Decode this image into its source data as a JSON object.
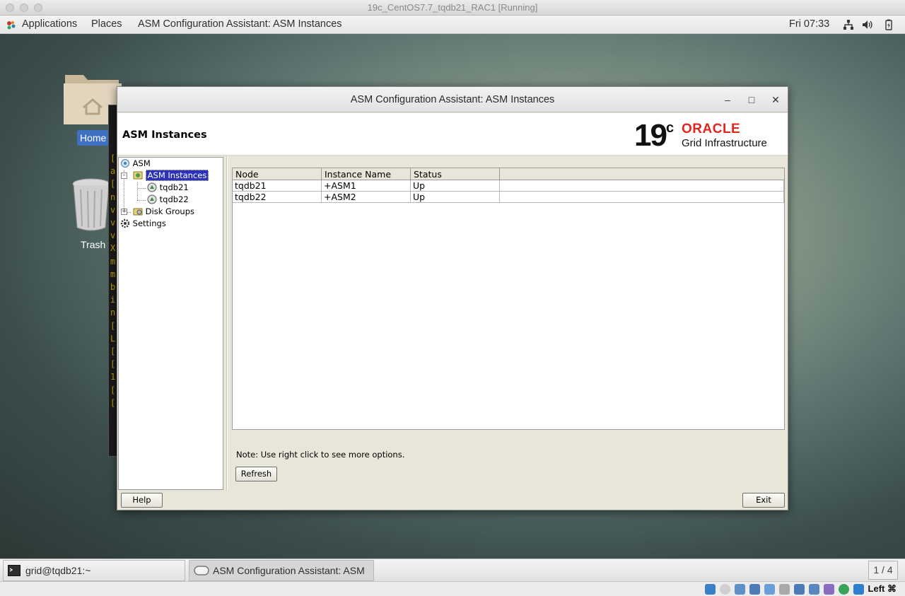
{
  "host_window": {
    "title": "19c_CentOS7.7_tqdb21_RAC1 [Running]"
  },
  "topbar": {
    "applications": "Applications",
    "places": "Places",
    "active_app": "ASM Configuration Assistant: ASM Instances",
    "clock": "Fri 07:33"
  },
  "desktop": {
    "home_label": "Home",
    "trash_label": "Trash"
  },
  "bg_terminal": {
    "lines": [
      "[",
      "a",
      "[",
      "n",
      "v",
      "v",
      "v",
      "X",
      "m",
      "m",
      "b",
      "i",
      "n",
      "[",
      "L",
      "[",
      "[",
      "1",
      "[",
      "["
    ]
  },
  "window": {
    "title": "ASM Configuration Assistant: ASM Instances",
    "minimize": "–",
    "maximize": "□",
    "close": "✕",
    "header_title": "ASM Instances",
    "logo": {
      "version": "19",
      "version_suffix": "c",
      "brand": "ORACLE",
      "product": "Grid Infrastructure",
      "brand_color": "#e3261d"
    },
    "tree": {
      "root": "ASM",
      "instances": "ASM Instances",
      "node1": "tqdb21",
      "node2": "tqdb22",
      "disk_groups": "Disk Groups",
      "settings": "Settings"
    },
    "table": {
      "columns": [
        "Node",
        "Instance Name",
        "Status",
        ""
      ],
      "rows": [
        [
          "tqdb21",
          "+ASM1",
          "Up"
        ],
        [
          "tqdb22",
          "+ASM2",
          "Up"
        ]
      ]
    },
    "note": "Note: Use right click to see more options.",
    "refresh_button": "Refresh",
    "help_button": "Help",
    "exit_button": "Exit"
  },
  "taskbar": {
    "terminal_task": "grid@tqdb21:~",
    "asmca_task": "ASM Configuration Assistant: ASM I...",
    "workspace": "1 / 4"
  },
  "vbox_status": {
    "host_key": "Left ⌘"
  }
}
